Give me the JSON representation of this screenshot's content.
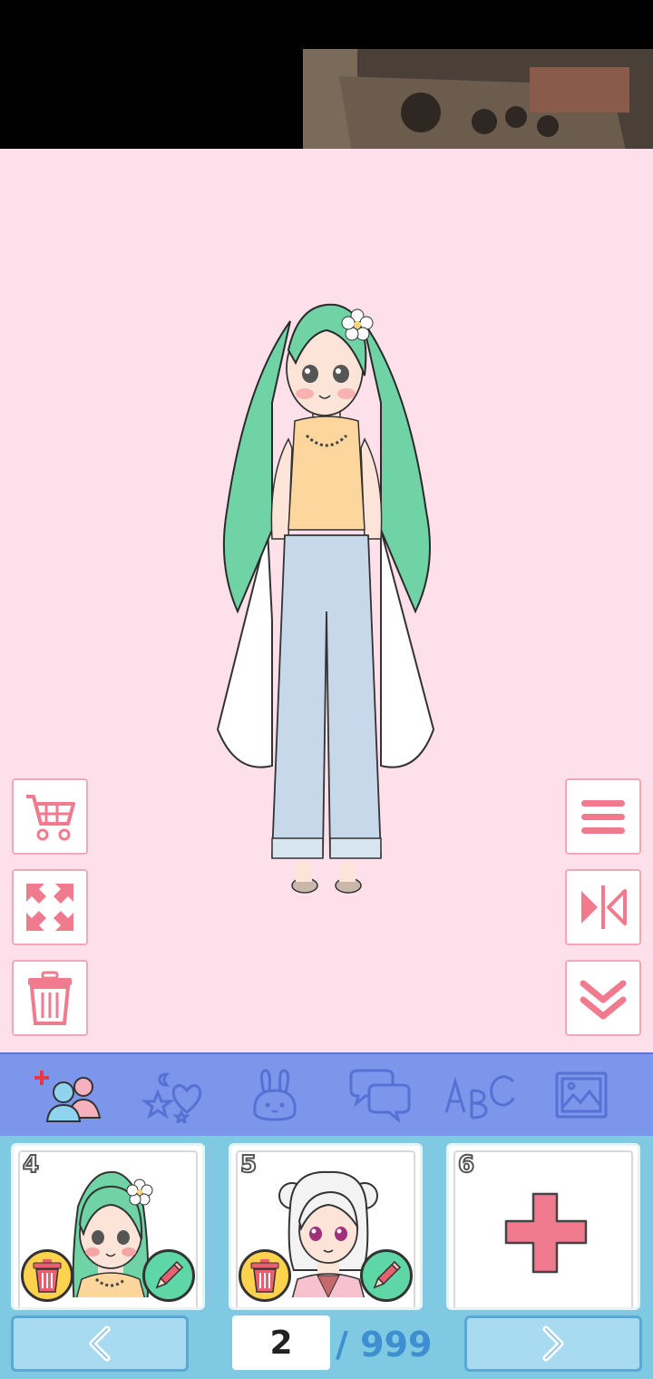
{
  "video_ad": {
    "label": "video-thumbnail"
  },
  "left_tools": [
    {
      "name": "cart-button",
      "icon": "cart-icon"
    },
    {
      "name": "expand-button",
      "icon": "expand-arrows-icon"
    },
    {
      "name": "delete-button",
      "icon": "trash-icon"
    }
  ],
  "right_tools": [
    {
      "name": "menu-button",
      "icon": "hamburger-icon"
    },
    {
      "name": "flip-button",
      "icon": "mirror-flip-icon"
    },
    {
      "name": "collapse-button",
      "icon": "chevron-double-down-icon"
    }
  ],
  "tabs": [
    {
      "name": "tab-characters",
      "icon": "add-people-icon",
      "active": true
    },
    {
      "name": "tab-stickers",
      "icon": "stars-heart-icon"
    },
    {
      "name": "tab-pets",
      "icon": "bunny-icon"
    },
    {
      "name": "tab-speech",
      "icon": "speech-bubbles-icon"
    },
    {
      "name": "tab-text",
      "icon": "abc-icon"
    },
    {
      "name": "tab-background",
      "icon": "image-icon"
    }
  ],
  "slots": [
    {
      "number": "4"
    },
    {
      "number": "5"
    },
    {
      "number": "6"
    }
  ],
  "pagination": {
    "current": "2",
    "total": "/ 999"
  },
  "colors": {
    "accent_pink": "#f07b8e",
    "tab_blue": "#7b96ea",
    "panel_blue": "#7fc9e3",
    "stage": "#fde0ea"
  }
}
